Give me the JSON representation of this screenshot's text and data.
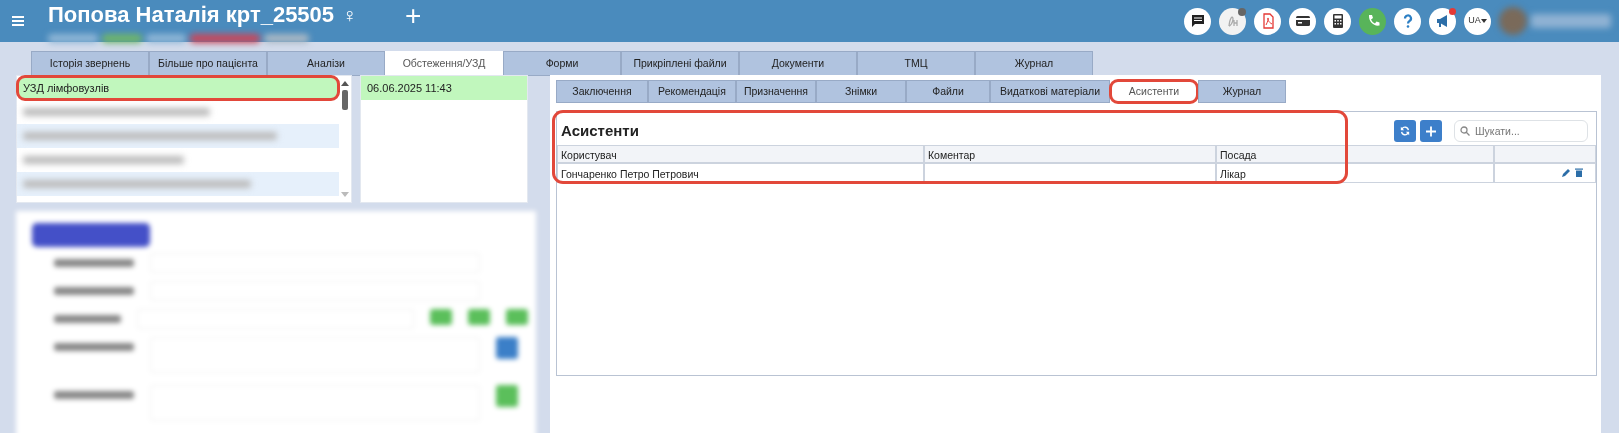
{
  "header": {
    "title": "Попова Наталія крт_25505",
    "gender_sign": "♀",
    "add_label": "+",
    "language": "UA",
    "redacted": true
  },
  "tabs": [
    {
      "label": "Історія звернень",
      "selected": false
    },
    {
      "label": "Більше про пацієнта",
      "selected": false
    },
    {
      "label": "Аналізи",
      "selected": false
    },
    {
      "label": "Обстеження/УЗД",
      "selected": true
    },
    {
      "label": "Форми",
      "selected": false
    },
    {
      "label": "Прикріплені файли",
      "selected": false
    },
    {
      "label": "Документи",
      "selected": false
    },
    {
      "label": "ТМЦ",
      "selected": false
    },
    {
      "label": "Журнал",
      "selected": false
    }
  ],
  "exams": [
    {
      "kind": "text",
      "title": "УЗД лімфовузлів",
      "selected": true,
      "highlighted": true
    },
    {
      "kind": "redacted",
      "selected": false,
      "highlighted": false
    },
    {
      "kind": "redacted",
      "selected": false,
      "highlighted": false
    },
    {
      "kind": "redacted",
      "selected": false,
      "highlighted": false
    },
    {
      "kind": "redacted",
      "selected": false,
      "highlighted": false
    }
  ],
  "dates": [
    {
      "text": "06.06.2025 11:43",
      "selected": true
    }
  ],
  "details_form": {
    "kind": "redacted"
  },
  "subtabs": [
    {
      "label": "Заключення",
      "selected": false,
      "highlighted": false
    },
    {
      "label": "Рекомендація",
      "selected": false,
      "highlighted": false
    },
    {
      "label": "Призначення",
      "selected": false,
      "highlighted": false
    },
    {
      "label": "Знімки",
      "selected": false,
      "highlighted": false
    },
    {
      "label": "Файли",
      "selected": false,
      "highlighted": false
    },
    {
      "label": "Видаткові матеріали",
      "selected": false,
      "highlighted": false
    },
    {
      "label": "Асистенти",
      "selected": true,
      "highlighted": true
    },
    {
      "label": "Журнал",
      "selected": false,
      "highlighted": false
    }
  ],
  "assistants": {
    "title": "Асистенти",
    "highlighted": true,
    "search": {
      "placeholder": "Шукати..."
    },
    "columns": [
      "Користувач",
      "Коментар",
      "Посада"
    ],
    "rows": [
      {
        "user": "Гончаренко Петро Петрович",
        "position": "Лікар"
      }
    ]
  }
}
